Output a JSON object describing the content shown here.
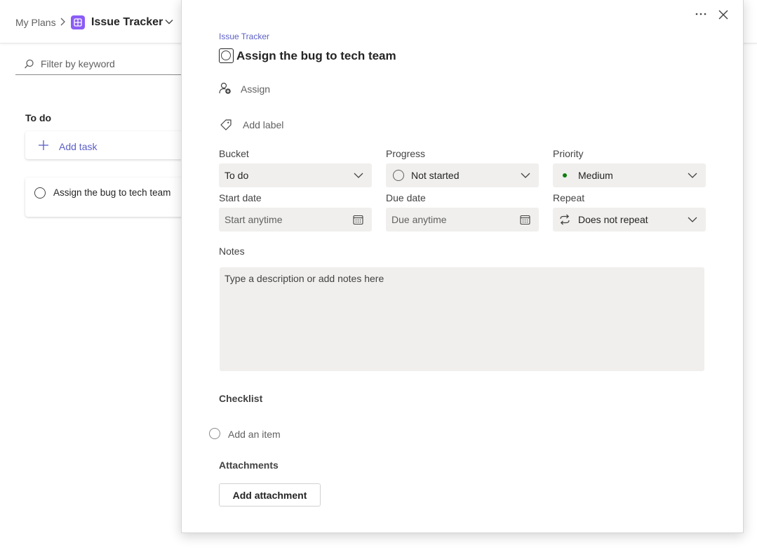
{
  "board": {
    "breadcrumb_root": "My Plans",
    "plan_name": "Issue Tracker",
    "filter_placeholder": "Filter by keyword",
    "bucket_title": "To do",
    "add_task_label": "Add task",
    "task_card_title": "Assign the bug to tech team",
    "plan_icon_color": "#8b5cf6"
  },
  "panel": {
    "plan_name": "Issue Tracker",
    "task_title": "Assign the bug to tech team",
    "assign_label": "Assign",
    "add_label_label": "Add label",
    "fields": {
      "bucket": {
        "label": "Bucket",
        "value": "To do"
      },
      "progress": {
        "label": "Progress",
        "value": "Not started"
      },
      "priority": {
        "label": "Priority",
        "value": "Medium",
        "dot_color": "#107c10"
      },
      "start_date": {
        "label": "Start date",
        "placeholder": "Start anytime"
      },
      "due_date": {
        "label": "Due date",
        "placeholder": "Due anytime"
      },
      "repeat": {
        "label": "Repeat",
        "value": "Does not repeat"
      }
    },
    "notes": {
      "label": "Notes",
      "placeholder": "Type a description or add notes here"
    },
    "checklist": {
      "label": "Checklist",
      "add_item": "Add an item"
    },
    "attachments": {
      "label": "Attachments",
      "button": "Add attachment"
    },
    "more_icon": "more-horizontal-icon",
    "close_icon": "close-icon",
    "accent_color": "#5b5fc7"
  }
}
